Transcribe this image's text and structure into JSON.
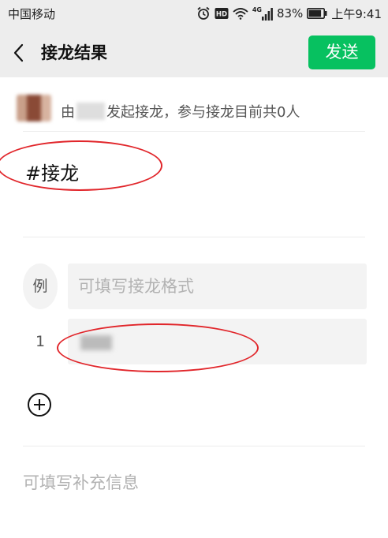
{
  "status_bar": {
    "carrier": "中国移动",
    "network": "4G",
    "battery": "83%",
    "time": "上午9:41",
    "icons": [
      "alarm-icon",
      "hd-icon",
      "wifi-icon",
      "signal-icon",
      "battery-icon"
    ]
  },
  "nav": {
    "title": "接龙结果",
    "send_label": "发送",
    "back_icon": "chevron-left-icon"
  },
  "initiator": {
    "prefix": "由",
    "suffix": "发起接龙，参与接龙目前共0人"
  },
  "topic": {
    "text": "#接龙"
  },
  "entries": {
    "example_index": "例",
    "example_placeholder": "可填写接龙格式",
    "first_index": "1"
  },
  "add_icon": "plus-circle-icon",
  "supplement": {
    "placeholder": "可填写补充信息"
  },
  "colors": {
    "accent_green": "#07c160",
    "header_bg": "#ededed",
    "annotation_red": "#e1262b"
  }
}
